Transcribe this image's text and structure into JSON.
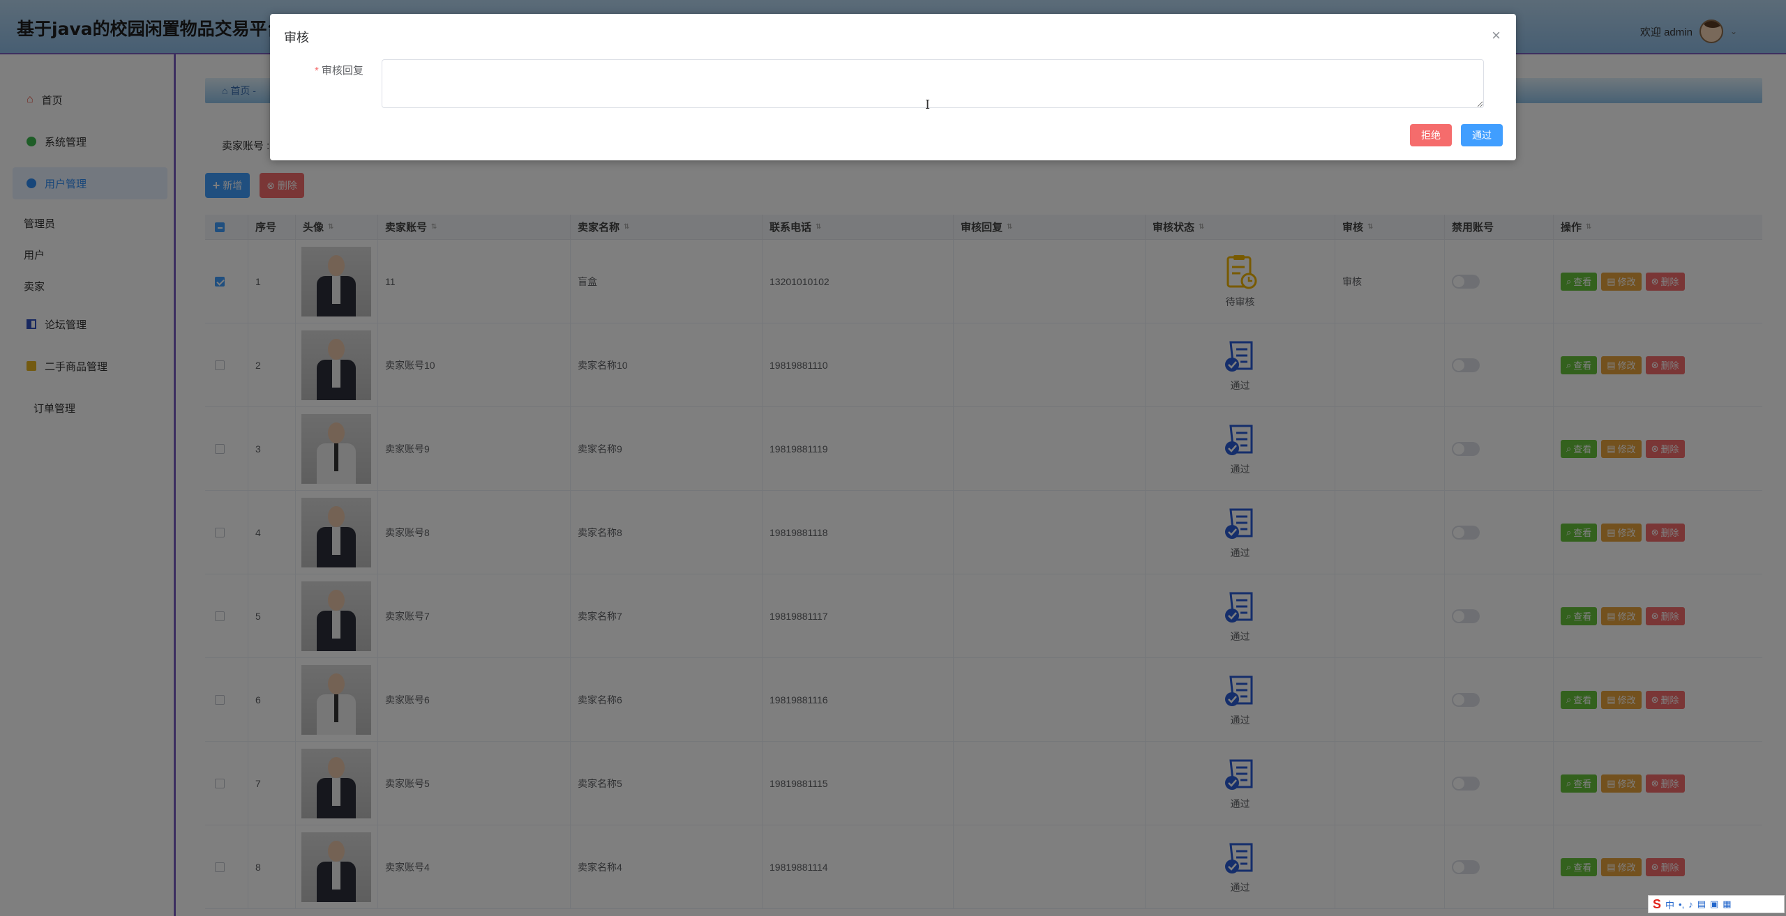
{
  "header": {
    "title": "基于java的校园闲置物品交易平台",
    "welcome": "欢迎 admin"
  },
  "sidebar": {
    "items": [
      {
        "label": "首页",
        "icon": "home-icon"
      },
      {
        "label": "系统管理",
        "icon": "dot-green"
      },
      {
        "label": "用户管理",
        "icon": "dot-blue",
        "active": true
      },
      {
        "label": "论坛管理",
        "icon": "book-icon"
      },
      {
        "label": "二手商品管理",
        "icon": "square-yellow"
      },
      {
        "label": "订单管理",
        "icon": ""
      }
    ],
    "sub_items": [
      "管理员",
      "用户",
      "卖家"
    ]
  },
  "breadcrumb": {
    "home": "首页",
    "sep": "-"
  },
  "search": {
    "label": "卖家账号 :"
  },
  "toolbar": {
    "add": "新增",
    "delete": "删除"
  },
  "table": {
    "columns": [
      "序号",
      "头像",
      "卖家账号",
      "卖家名称",
      "联系电话",
      "审核回复",
      "审核状态",
      "审核",
      "禁用账号",
      "操作"
    ],
    "rows": [
      {
        "index": "1",
        "account": "11",
        "name": "盲盒",
        "phone": "13201010102",
        "reply": "",
        "status": "待审核",
        "audit": "审核",
        "checked": true
      },
      {
        "index": "2",
        "account": "卖家账号10",
        "name": "卖家名称10",
        "phone": "19819881110",
        "reply": "",
        "status": "通过",
        "audit": "",
        "checked": false
      },
      {
        "index": "3",
        "account": "卖家账号9",
        "name": "卖家名称9",
        "phone": "19819881119",
        "reply": "",
        "status": "通过",
        "audit": "",
        "checked": false
      },
      {
        "index": "4",
        "account": "卖家账号8",
        "name": "卖家名称8",
        "phone": "19819881118",
        "reply": "",
        "status": "通过",
        "audit": "",
        "checked": false
      },
      {
        "index": "5",
        "account": "卖家账号7",
        "name": "卖家名称7",
        "phone": "19819881117",
        "reply": "",
        "status": "通过",
        "audit": "",
        "checked": false
      },
      {
        "index": "6",
        "account": "卖家账号6",
        "name": "卖家名称6",
        "phone": "19819881116",
        "reply": "",
        "status": "通过",
        "audit": "",
        "checked": false
      },
      {
        "index": "7",
        "account": "卖家账号5",
        "name": "卖家名称5",
        "phone": "19819881115",
        "reply": "",
        "status": "通过",
        "audit": "",
        "checked": false
      },
      {
        "index": "8",
        "account": "卖家账号4",
        "name": "卖家名称4",
        "phone": "19819881114",
        "reply": "",
        "status": "通过",
        "audit": "",
        "checked": false
      }
    ],
    "ops": {
      "view": "查看",
      "edit": "修改",
      "delete": "删除"
    }
  },
  "dialog": {
    "title": "审核",
    "field_label": "审核回复",
    "field_value": "",
    "reject": "拒绝",
    "pass": "通过"
  },
  "ime": {
    "lang": "中"
  },
  "colors": {
    "primary": "#409eff",
    "danger": "#f56c6c",
    "success": "#67c23a",
    "warning": "#e6a23c",
    "sidebar_border": "#7a5fc0"
  }
}
